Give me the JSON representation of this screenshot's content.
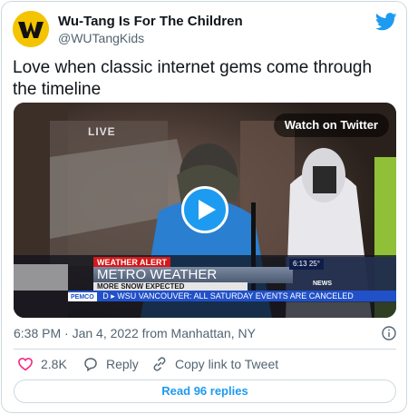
{
  "author": {
    "display_name": "Wu-Tang Is For The Children",
    "handle": "@WUTangKids"
  },
  "tweet": {
    "text": "Love when classic internet gems come through the timeline",
    "timestamp": "6:38 PM · Jan 4, 2022 from Manhattan, NY"
  },
  "media": {
    "watch_label": "Watch on Twitter",
    "live_label": "LIVE",
    "overlay": {
      "alert": "WEATHER ALERT",
      "title": "METRO WEATHER",
      "subtitle": "MORE SNOW EXPECTED",
      "sponsor": "PEMCO",
      "ticker": "D  ▸  WSU VANCOUVER: ALL SATURDAY EVENTS ARE CANCELED",
      "time": "6:13",
      "temp": "25°",
      "news": "NEWS"
    }
  },
  "actions": {
    "likes": "2.8K",
    "reply_label": "Reply",
    "copy_label": "Copy link to Tweet",
    "read_replies": "Read 96 replies"
  },
  "colors": {
    "accent": "#1d9bf0",
    "like_red": "#f91880",
    "text_secondary": "#536471",
    "border": "#cfd9de"
  },
  "icons": [
    "wu-tang-avatar",
    "twitter-bird-icon",
    "play-icon",
    "info-icon",
    "heart-icon",
    "reply-icon",
    "link-icon"
  ]
}
